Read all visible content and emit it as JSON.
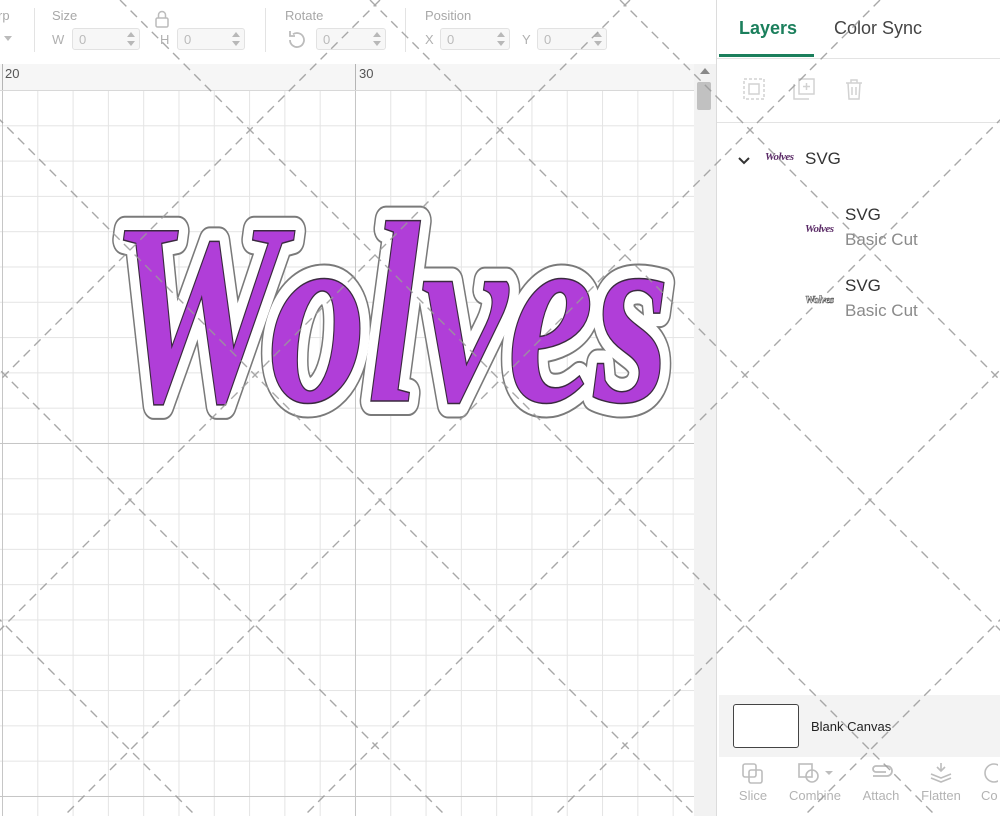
{
  "toolbar": {
    "group_warp_label": "rp",
    "group_size_label": "Size",
    "group_rotate_label": "Rotate",
    "group_position_label": "Position",
    "w_axis": "W",
    "h_axis": "H",
    "x_axis": "X",
    "y_axis": "Y",
    "w_value": "0",
    "h_value": "0",
    "rotate_value": "0",
    "x_value": "0",
    "y_value": "0"
  },
  "canvas": {
    "ruler_labels": [
      "20",
      "30"
    ],
    "artwork_text": "Wolves",
    "fill_color": "#b03ed8",
    "outline_color": "#7a7a7a",
    "grid_color": "#c6c6c6"
  },
  "panel": {
    "tabs": {
      "layers": "Layers",
      "color_sync": "Color Sync"
    },
    "layer_group": {
      "name": "SVG",
      "thumb_text": "Wolves"
    },
    "layers": [
      {
        "name": "SVG",
        "type": "Basic Cut",
        "thumb_text": "Wolves"
      },
      {
        "name": "SVG",
        "type": "Basic Cut",
        "thumb_text": "Wolves"
      }
    ],
    "blank_canvas_label": "Blank Canvas",
    "actions": [
      "Slice",
      "Combine",
      "Attach",
      "Flatten",
      "Co"
    ]
  },
  "colors": {
    "accent": "#1b7f5c",
    "purple": "#b03ed8"
  }
}
